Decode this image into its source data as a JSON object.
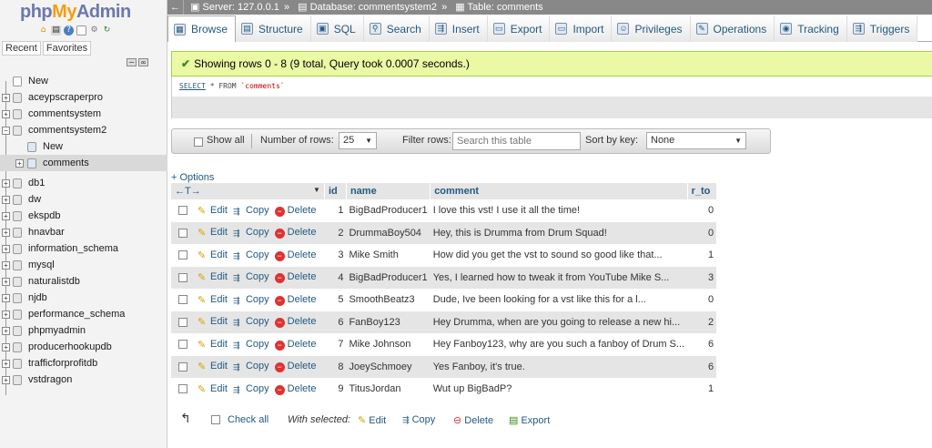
{
  "logo": {
    "php": "php",
    "my": "My",
    "admin": "Admin"
  },
  "nav_tabs": [
    "Recent",
    "Favorites"
  ],
  "tree": {
    "new_label": "New",
    "databases": [
      {
        "name": "aceypscraperpro"
      },
      {
        "name": "commentsystem"
      },
      {
        "name": "commentsystem2"
      },
      {
        "name": "db1"
      },
      {
        "name": "dw"
      },
      {
        "name": "ekspdb"
      },
      {
        "name": "hnavbar"
      },
      {
        "name": "information_schema"
      },
      {
        "name": "mysql"
      },
      {
        "name": "naturalistdb"
      },
      {
        "name": "njdb"
      },
      {
        "name": "performance_schema"
      },
      {
        "name": "phpmyadmin"
      },
      {
        "name": "producerhookupdb"
      },
      {
        "name": "trafficforprofitdb"
      },
      {
        "name": "vstdragon"
      }
    ],
    "sub_new": "New",
    "sub_table": "comments"
  },
  "breadcrumb": {
    "server": "Server: 127.0.0.1",
    "database": "Database: commentsystem2",
    "table": "Table: comments",
    "sep": "»"
  },
  "menu": [
    {
      "label": "Browse",
      "icon": "browse-icon",
      "glyph": "▦"
    },
    {
      "label": "Structure",
      "icon": "structure-icon",
      "glyph": "▤"
    },
    {
      "label": "SQL",
      "icon": "sql-icon",
      "glyph": "▣"
    },
    {
      "label": "Search",
      "icon": "search-icon",
      "glyph": "⚲"
    },
    {
      "label": "Insert",
      "icon": "insert-icon",
      "glyph": "⇶"
    },
    {
      "label": "Export",
      "icon": "export-icon",
      "glyph": "▭"
    },
    {
      "label": "Import",
      "icon": "import-icon",
      "glyph": "▭"
    },
    {
      "label": "Privileges",
      "icon": "privileges-icon",
      "glyph": "☺"
    },
    {
      "label": "Operations",
      "icon": "operations-icon",
      "glyph": "✎"
    },
    {
      "label": "Tracking",
      "icon": "tracking-icon",
      "glyph": "◉"
    },
    {
      "label": "Triggers",
      "icon": "triggers-icon",
      "glyph": "⇶"
    }
  ],
  "message": "Showing rows 0 - 8 (9 total, Query took 0.0007 seconds.)",
  "sql": {
    "select": "SELECT",
    "rest": " * FROM ",
    "table": "`comments`"
  },
  "toolbar": {
    "show_all": "Show all",
    "num_rows_label": "Number of rows:",
    "num_rows_value": "25",
    "filter_label": "Filter rows:",
    "filter_placeholder": "Search this table",
    "sort_label": "Sort by key:",
    "sort_value": "None"
  },
  "options_link": "+ Options",
  "columns": [
    "id",
    "name",
    "comment",
    "r_to"
  ],
  "actions": {
    "edit": "Edit",
    "copy": "Copy",
    "delete": "Delete"
  },
  "rows": [
    {
      "id": "1",
      "name": "BigBadProducer1",
      "comment": "I love this vst! I use it all the time!",
      "r_to": "0"
    },
    {
      "id": "2",
      "name": "DrummaBoy504",
      "comment": "Hey, this is Drumma from Drum Squad!",
      "r_to": "0"
    },
    {
      "id": "3",
      "name": "Mike Smith",
      "comment": "How did you get the vst to sound so good like that...",
      "r_to": "1"
    },
    {
      "id": "4",
      "name": "BigBadProducer1",
      "comment": "Yes, I learned how to tweak it from YouTube Mike S...",
      "r_to": "3"
    },
    {
      "id": "5",
      "name": "SmoothBeatz3",
      "comment": "Dude, Ive been looking for a vst like this for a l...",
      "r_to": "0"
    },
    {
      "id": "6",
      "name": "FanBoy123",
      "comment": "Hey Drumma, when are you going to release a new hi...",
      "r_to": "2"
    },
    {
      "id": "7",
      "name": "Mike Johnson",
      "comment": "Hey Fanboy123, why are you such a fanboy of Drum S...",
      "r_to": "6"
    },
    {
      "id": "8",
      "name": "JoeySchmoey",
      "comment": "Yes Fanboy, it's true.",
      "r_to": "6"
    },
    {
      "id": "9",
      "name": "TitusJordan",
      "comment": "Wut up BigBadP?",
      "r_to": "1"
    }
  ],
  "bottom": {
    "check_all": "Check all",
    "with_selected": "With selected:",
    "edit": "Edit",
    "copy": "Copy",
    "delete": "Delete",
    "export": "Export"
  }
}
